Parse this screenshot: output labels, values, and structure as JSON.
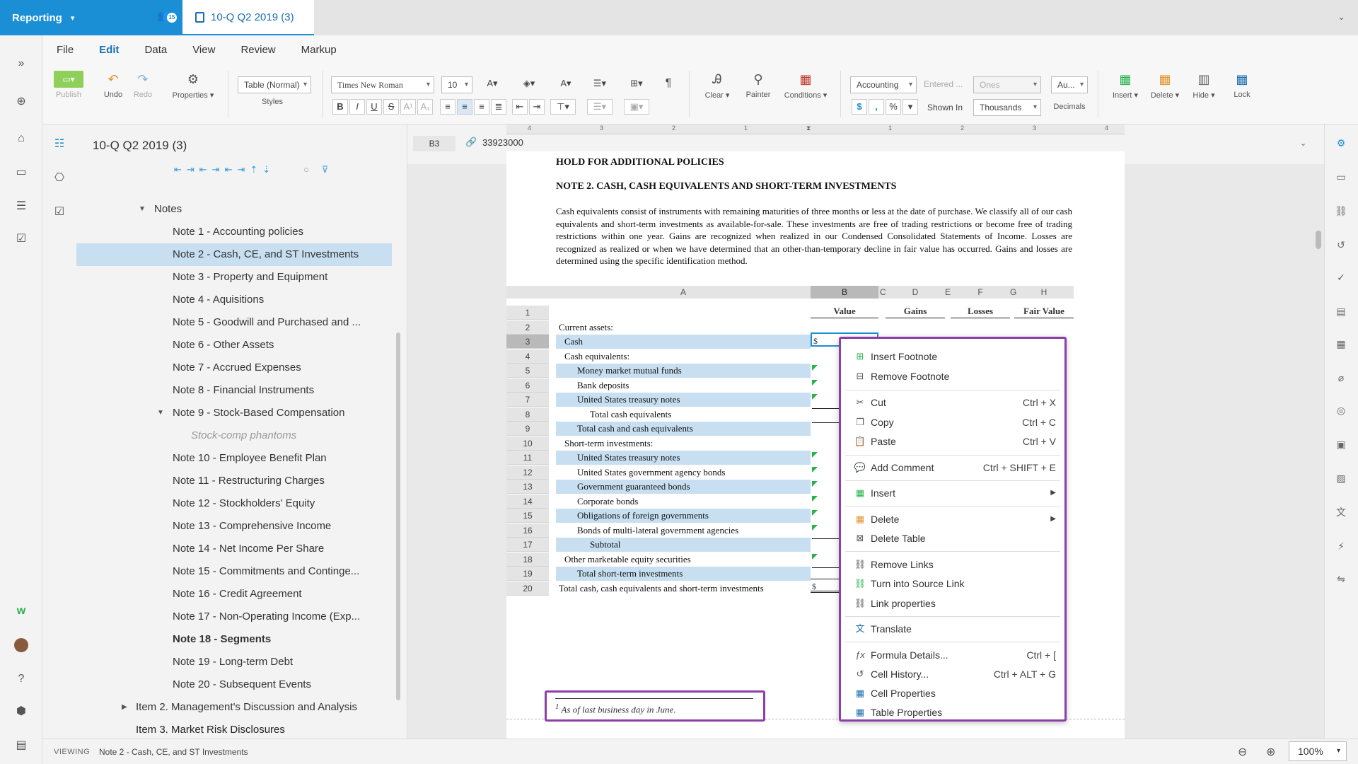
{
  "topbar": {
    "app_name": "Reporting",
    "notif_count": "15",
    "doc_tab": "10-Q Q2 2019 (3)"
  },
  "menu": [
    "File",
    "Edit",
    "Data",
    "View",
    "Review",
    "Markup"
  ],
  "ribbon": {
    "publish": "Publish",
    "undo": "Undo",
    "redo": "Redo",
    "properties": "Properties",
    "style_select": "Table (Normal)",
    "styles": "Styles",
    "font": "Times New Roman",
    "font_size": "10",
    "clear": "Clear",
    "painter": "Painter",
    "conditions": "Conditions",
    "number_format": "Accounting",
    "entered": "Entered ...",
    "ones": "Ones",
    "shown_in_label": "Shown In",
    "shown_in": "Thousands",
    "au": "Au...",
    "decimals": "Decimals",
    "insert": "Insert",
    "delete": "Delete",
    "hide": "Hide",
    "lock": "Lock"
  },
  "outline": {
    "title": "10-Q Q2 2019 (3)",
    "items": [
      {
        "label": "Notes"
      },
      {
        "label": "Note 1 - Accounting policies"
      },
      {
        "label": "Note 2 - Cash, CE, and ST Investments"
      },
      {
        "label": "Note 3 - Property and Equipment"
      },
      {
        "label": "Note 4 - Aquisitions"
      },
      {
        "label": "Note 5 - Goodwill and Purchased and ..."
      },
      {
        "label": "Note 6 - Other Assets"
      },
      {
        "label": "Note 7 - Accrued Expenses"
      },
      {
        "label": "Note 8 - Financial Instruments"
      },
      {
        "label": "Note 9 - Stock-Based Compensation"
      },
      {
        "label": "Stock-comp phantoms"
      },
      {
        "label": "Note 10 - Employee Benefit Plan"
      },
      {
        "label": "Note 11 - Restructuring Charges"
      },
      {
        "label": "Note 12 - Stockholders' Equity"
      },
      {
        "label": "Note 13 - Comprehensive Income"
      },
      {
        "label": "Note 14 - Net Income Per Share"
      },
      {
        "label": "Note 15 - Commitments and Continge..."
      },
      {
        "label": "Note 16 - Credit Agreement"
      },
      {
        "label": "Note 17 - Non-Operating Income (Exp..."
      },
      {
        "label": "Note 18 - Segments"
      },
      {
        "label": "Note 19 - Long-term Debt"
      },
      {
        "label": "Note 20 - Subsequent Events"
      },
      {
        "label": "Item 2. Management's Discussion and Analysis"
      },
      {
        "label": "Item 3. Market Risk Disclosures"
      }
    ]
  },
  "formula_bar": {
    "cell_ref": "B3",
    "value": "33923000"
  },
  "ruler": [
    "4",
    "3",
    "2",
    "1",
    "1",
    "2",
    "3",
    "4"
  ],
  "document": {
    "heading1": "HOLD FOR ADDITIONAL POLICIES",
    "heading2": "NOTE 2. CASH, CASH EQUIVALENTS AND SHORT-TERM INVESTMENTS",
    "paragraph": "Cash equivalents consist of instruments with remaining maturities of three months or less at the date of purchase. We classify all of our cash equivalents and short-term investments as available-for-sale. These investments are free of trading restrictions or become free of trading restrictions within one year.  Gains are recognized when realized in our Condensed Consolidated Statements of Income. Losses are recognized as realized or when we have determined that an other-than-temporary decline in fair value has occurred. Gains and losses are determined using the specific identification method.",
    "footnote": "As of last business day in June.",
    "footnote_mark": "1"
  },
  "table": {
    "col_letters": [
      "A",
      "B",
      "C",
      "D",
      "E",
      "F",
      "G",
      "H"
    ],
    "headers": [
      "Value",
      "Gains",
      "Losses",
      "Fair Value"
    ],
    "dollar": "$",
    "rows": [
      {
        "n": "1",
        "a": ""
      },
      {
        "n": "2",
        "a": "Current assets:"
      },
      {
        "n": "3",
        "a": "Cash"
      },
      {
        "n": "4",
        "a": "Cash equivalents:"
      },
      {
        "n": "5",
        "a": "Money market mutual funds"
      },
      {
        "n": "6",
        "a": "Bank deposits"
      },
      {
        "n": "7",
        "a": "United States treasury notes"
      },
      {
        "n": "8",
        "a": "Total cash equivalents"
      },
      {
        "n": "9",
        "a": "Total cash and cash equivalents"
      },
      {
        "n": "10",
        "a": "Short-term investments:"
      },
      {
        "n": "11",
        "a": "United States treasury notes"
      },
      {
        "n": "12",
        "a": "United States government agency bonds"
      },
      {
        "n": "13",
        "a": "Government guaranteed bonds"
      },
      {
        "n": "14",
        "a": "Corporate bonds"
      },
      {
        "n": "15",
        "a": "Obligations of foreign governments"
      },
      {
        "n": "16",
        "a": "Bonds of multi-lateral government agencies"
      },
      {
        "n": "17",
        "a": "Subtotal"
      },
      {
        "n": "18",
        "a": "Other marketable equity securities"
      },
      {
        "n": "19",
        "a": "Total short-term investments"
      },
      {
        "n": "20",
        "a": "Total cash, cash equivalents and short-term investments"
      }
    ]
  },
  "context_menu": [
    {
      "label": "Insert Footnote",
      "shortcut": ""
    },
    {
      "label": "Remove Footnote",
      "shortcut": ""
    },
    {
      "label": "Cut",
      "shortcut": "Ctrl + X"
    },
    {
      "label": "Copy",
      "shortcut": "Ctrl + C"
    },
    {
      "label": "Paste",
      "shortcut": "Ctrl + V"
    },
    {
      "label": "Add Comment",
      "shortcut": "Ctrl + SHIFT + E"
    },
    {
      "label": "Insert",
      "shortcut": ""
    },
    {
      "label": "Delete",
      "shortcut": ""
    },
    {
      "label": "Delete Table",
      "shortcut": ""
    },
    {
      "label": "Remove Links",
      "shortcut": ""
    },
    {
      "label": "Turn into Source Link",
      "shortcut": ""
    },
    {
      "label": "Link properties",
      "shortcut": ""
    },
    {
      "label": "Translate",
      "shortcut": ""
    },
    {
      "label": "Formula Details...",
      "shortcut": "Ctrl + ["
    },
    {
      "label": "Cell History...",
      "shortcut": "Ctrl + ALT + G"
    },
    {
      "label": "Cell Properties",
      "shortcut": ""
    },
    {
      "label": "Table Properties",
      "shortcut": ""
    }
  ],
  "status": {
    "viewing": "VIEWING",
    "path": "Note 2 - Cash, CE, and ST Investments",
    "zoom": "100%"
  },
  "colors": {
    "accent": "#1a8fd6",
    "highlight": "#c7dff0",
    "annotation": "#8c3fa6",
    "green_flag": "#27b24a"
  }
}
